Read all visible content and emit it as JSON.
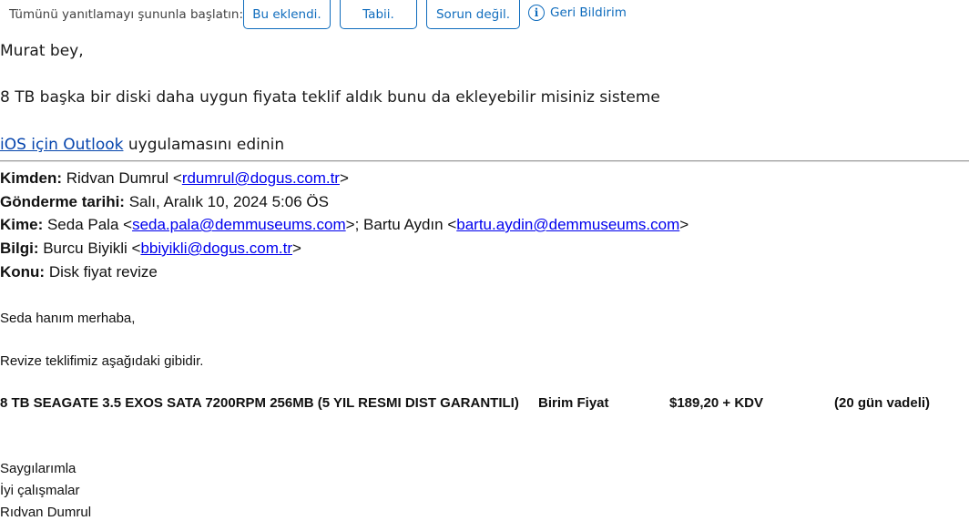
{
  "suggested_replies": {
    "prompt": "Tümünü yanıtlamayı şununla başlatın:",
    "chips": [
      "Bu eklendi.",
      "Tabii.",
      "Sorun değil."
    ],
    "feedback_label": "Geri Bildirim",
    "feedback_icon": "info-icon"
  },
  "message": {
    "greeting": "Murat bey,",
    "request": "8 TB başka bir diski daha uygun fiyata teklif aldık bunu da ekleyebilir misiniz sisteme",
    "signature_link": "iOS için Outlook",
    "signature_rest": " uygulamasını edinin"
  },
  "forwarded": {
    "from_label": "Kimden:",
    "from_name": " Ridvan Dumrul <",
    "from_email": "rdumrul@dogus.com.tr",
    "sent_label": "Gönderme tarihi:",
    "sent_value": " Salı, Aralık 10, 2024 5:06 ÖS",
    "to_label": "Kime:",
    "to_name1": " Seda Pala <",
    "to_email1": "seda.pala@demmuseums.com",
    "to_sep": ">; Bartu Aydın <",
    "to_email2": "bartu.aydin@demmuseums.com",
    "cc_label": "Bilgi:",
    "cc_name": " Burcu Biyikli <",
    "cc_email": "bbiyikli@dogus.com.tr",
    "subject_label": "Konu:",
    "subject_value": " Disk fiyat revize",
    "close_bracket": ">"
  },
  "quoted": {
    "greeting": "Seda hanım merhaba,",
    "intro": "Revize teklifimiz aşağıdaki gibidir.",
    "offer": {
      "product": "8 TB SEAGATE 3.5 EXOS SATA 7200RPM 256MB (5 YIL RESMI DIST GARANTILI)",
      "price_label": "Birim Fiyat",
      "price": "$189,20 + KDV",
      "terms": "(20 gün vadeli)"
    },
    "closing": [
      "Saygılarımla",
      "İyi çalışmalar",
      "Rıdvan Dumrul"
    ]
  }
}
